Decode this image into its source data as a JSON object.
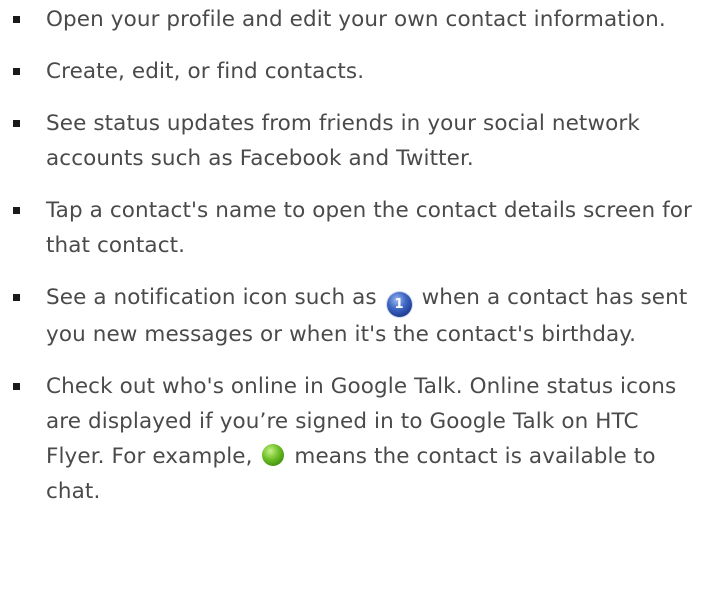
{
  "bullets": [
    {
      "text": "Open your profile and edit your own contact information."
    },
    {
      "text": "Create, edit, or find contacts."
    },
    {
      "text": "See status updates from friends in your social network accounts such as Facebook and Twitter."
    },
    {
      "text": "Tap a contact's name to open the contact details screen for that contact."
    },
    {
      "text_before": "See a notification icon such as",
      "icon": {
        "name": "notification-badge-icon",
        "label": "1",
        "color": "#2a4fae"
      },
      "text_after": "when a contact has sent you new messages or when it's the contact's birthday."
    },
    {
      "text_before": "Check out who's online in Google Talk. Online status icons are displayed if you’re signed in to Google Talk on HTC Flyer. For example,",
      "icon": {
        "name": "online-status-icon",
        "color": "#5cb81c"
      },
      "text_after": "means the contact is available to chat."
    }
  ]
}
